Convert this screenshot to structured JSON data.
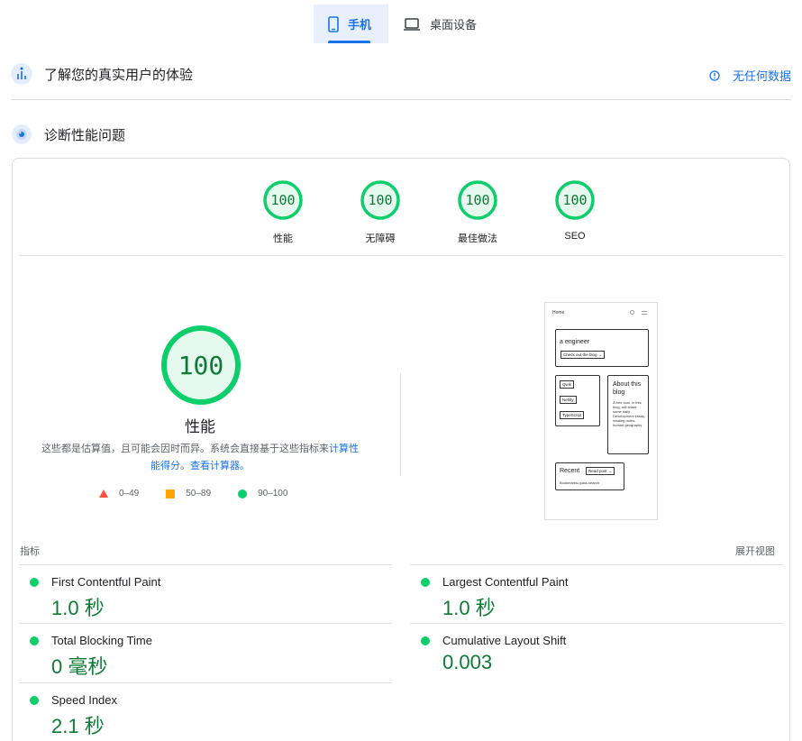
{
  "tabs": [
    {
      "label": "手机",
      "icon": "phone-icon",
      "active": true
    },
    {
      "label": "桌面设备",
      "icon": "laptop-icon",
      "active": false
    }
  ],
  "crux": {
    "title": "了解您的真实用户的体验",
    "no_data": "无任何数据"
  },
  "diagnose": {
    "title": "诊断性能问题"
  },
  "gauges": [
    {
      "score": "100",
      "label": "性能"
    },
    {
      "score": "100",
      "label": "无障碍"
    },
    {
      "score": "100",
      "label": "最佳做法"
    },
    {
      "score": "100",
      "label": "SEO"
    }
  ],
  "performance": {
    "score": "100",
    "title": "性能",
    "desc_prefix": "这些都是估算值，且可能会因时而异。系统会直接基于这些指标来",
    "desc_link1": "计算性能得分",
    "desc_mid": "。",
    "desc_link2": "查看计算器。"
  },
  "legend": [
    {
      "range": "0–49",
      "color": "#ff4e42",
      "shape": "triangle"
    },
    {
      "range": "50–89",
      "color": "#ffa400",
      "shape": "square"
    },
    {
      "range": "90–100",
      "color": "#0cce6b",
      "shape": "circle"
    }
  ],
  "screenshot": {
    "home": "Home",
    "hero": "a engineer",
    "hero_button": "Check out the blog →",
    "tags": [
      "Qwik",
      "Netlify",
      "TypeScript"
    ],
    "about_title": "About this blog",
    "about_text": "A free soul, in this blog, will share some daily Development essay, reading notes, human geography",
    "recent": "Recent",
    "read_post": "Read post →",
    "recent_item": "Bookmarks-quick-search"
  },
  "metrics_label": "指标",
  "expand_label": "展开视图",
  "metrics": [
    {
      "name": "First Contentful Paint",
      "value": "1.0 秒"
    },
    {
      "name": "Largest Contentful Paint",
      "value": "1.0 秒"
    },
    {
      "name": "Total Blocking Time",
      "value": "0 毫秒"
    },
    {
      "name": "Cumulative Layout Shift",
      "value": "0.003"
    },
    {
      "name": "Speed Index",
      "value": "2.1 秒"
    }
  ],
  "colors": {
    "accent": "#1a73e8",
    "pass": "#0cce6b",
    "pass_text": "#0d7a35"
  }
}
